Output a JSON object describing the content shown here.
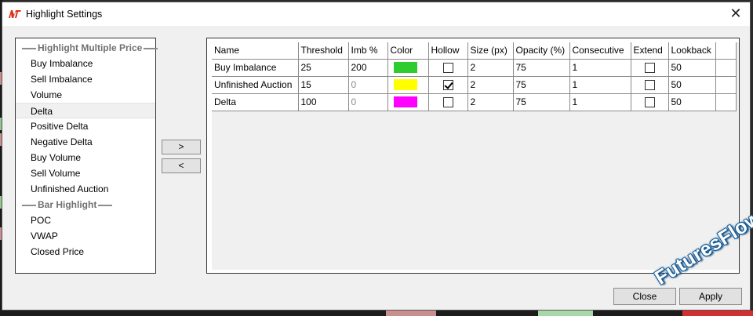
{
  "window": {
    "title": "Highlight Settings",
    "close_glyph": "✕"
  },
  "left_list": {
    "groups": [
      {
        "header": "Highlight Multiple Price",
        "items": [
          "Buy Imbalance",
          "Sell Imbalance",
          "Volume",
          "Delta",
          "Positive Delta",
          "Negative Delta",
          "Buy Volume",
          "Sell Volume",
          "Unfinished Auction"
        ]
      },
      {
        "header": "Bar Highlight",
        "items": [
          "POC",
          "VWAP",
          "Closed Price"
        ]
      }
    ],
    "selected": "Delta"
  },
  "buttons": {
    "add": ">",
    "remove": "<",
    "close": "Close",
    "apply": "Apply"
  },
  "grid": {
    "columns": [
      "Name",
      "Threshold",
      "Imb %",
      "Color",
      "Hollow",
      "Size (px)",
      "Opacity (%)",
      "Consecutive",
      "Extend",
      "Lookback"
    ],
    "rows": [
      {
        "name": "Buy Imbalance",
        "threshold": "25",
        "imb": "200",
        "imb_muted": false,
        "color": "#2ecc2e",
        "hollow": false,
        "size": "2",
        "opacity": "75",
        "consecutive": "1",
        "extend": false,
        "lookback": "50"
      },
      {
        "name": "Unfinished Auction",
        "threshold": "15",
        "imb": "0",
        "imb_muted": true,
        "color": "#ffff00",
        "hollow": true,
        "size": "2",
        "opacity": "75",
        "consecutive": "1",
        "extend": false,
        "lookback": "50"
      },
      {
        "name": "Delta",
        "threshold": "100",
        "imb": "0",
        "imb_muted": true,
        "color": "#ff00ff",
        "hollow": false,
        "size": "2",
        "opacity": "75",
        "consecutive": "1",
        "extend": false,
        "lookback": "50"
      }
    ]
  },
  "watermark": "FuturesFlow.io",
  "icons": {
    "app": "nt-logo-icon",
    "close": "close-icon",
    "checkbox": "checkbox-icon"
  },
  "colors": {
    "accent_watermark": "#1565a8",
    "logo_red": "#e0301e"
  }
}
